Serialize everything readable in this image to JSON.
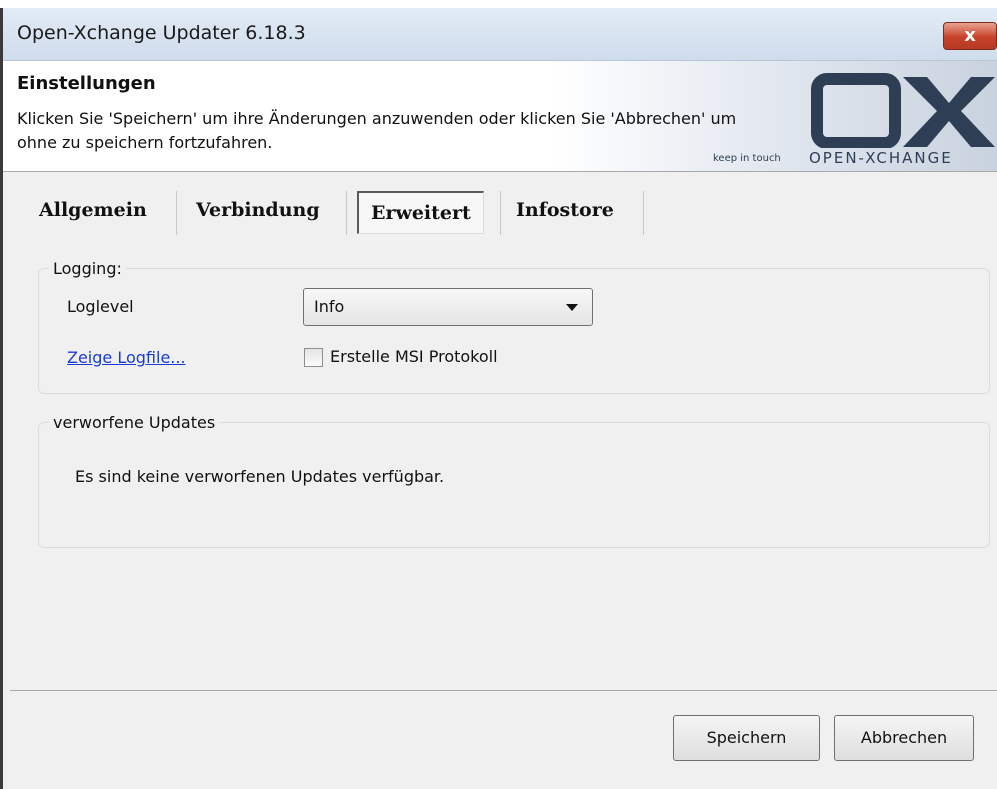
{
  "window": {
    "title": "Open-Xchange Updater 6.18.3",
    "close_label": "x"
  },
  "header": {
    "title": "Einstellungen",
    "description": "Klicken Sie 'Speichern' um ihre Änderungen anzuwenden oder klicken Sie 'Abbrechen' um ohne zu speichern fortzufahren.",
    "logo_tagline": "keep in touch",
    "logo_wordmark": "OPEN-XCHANGE",
    "logo_icon": "ox-logo-icon"
  },
  "tabs": [
    {
      "label": "Allgemein"
    },
    {
      "label": "Verbindung"
    },
    {
      "label": "Erweitert",
      "active": true
    },
    {
      "label": "Infostore"
    }
  ],
  "logging": {
    "legend": "Logging:",
    "loglevel_label": "Loglevel",
    "loglevel_value": "Info",
    "show_logfile_link": "Zeige Logfile...",
    "msi_checkbox_label": "Erstelle MSI Protokoll",
    "msi_checked": false
  },
  "discarded": {
    "legend": "verworfene Updates",
    "message": "Es sind keine verworfenen Updates verfügbar."
  },
  "buttons": {
    "save": "Speichern",
    "cancel": "Abbrechen"
  }
}
